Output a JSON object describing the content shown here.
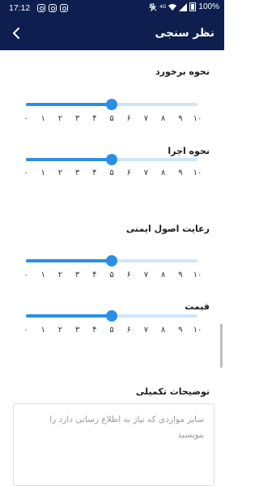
{
  "status_bar": {
    "time": "17:12",
    "network": "4G",
    "battery": "100%",
    "icons": [
      "instagram-icon",
      "instagram-icon",
      "instagram-icon",
      "mute-icon",
      "wifi-icon",
      "signal-icon",
      "battery-icon"
    ]
  },
  "app_bar": {
    "title": "نظر سنجی",
    "back_icon": "chevron-left-icon",
    "background": "#0e1f4f"
  },
  "slider_min": 0,
  "slider_max": 10,
  "accent_color": "#2b8ee6",
  "ticks": [
    "۰",
    "۱",
    "۲",
    "۳",
    "۴",
    "۵",
    "۶",
    "۷",
    "۸",
    "۹",
    "۱۰"
  ],
  "sections": [
    {
      "label": "نحوه برخورد",
      "value": 5
    },
    {
      "label": "نحوه اجرا",
      "value": 5
    },
    {
      "label": "رعایت اصول ایمنی",
      "value": 5
    },
    {
      "label": "قیمت",
      "value": 5
    }
  ],
  "notes": {
    "label": "توضیحات تکمیلی",
    "placeholder": "سایر مواردی که نیاز به اطلاع رسانی دارد را بنویسید",
    "value": ""
  }
}
